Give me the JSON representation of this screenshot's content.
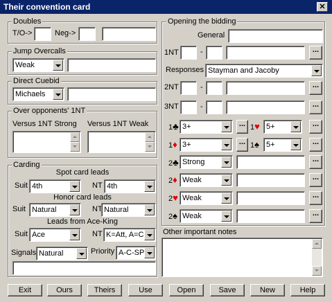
{
  "window": {
    "title": "Their convention card",
    "close_glyph": "✕"
  },
  "doubles": {
    "label": "Doubles",
    "to_label": "T/O->",
    "to_value": "",
    "neg_label": "Neg->",
    "neg_value": "",
    "notes": ""
  },
  "jump_overcalls": {
    "label": "Jump Overcalls",
    "value": "Weak",
    "notes": ""
  },
  "direct_cuebid": {
    "label": "Direct Cuebid",
    "value": "Michaels",
    "notes": ""
  },
  "over_1nt": {
    "label": "Over opponents' 1NT",
    "strong_label": "Versus 1NT Strong",
    "weak_label": "Versus 1NT Weak",
    "strong_value": "",
    "weak_value": ""
  },
  "carding": {
    "label": "Carding",
    "spot_label": "Spot card leads",
    "honor_label": "Honor card leads",
    "ace_king_label": "Leads from Ace-King",
    "suit_label": "Suit",
    "nt_label": "NT",
    "spot_suit": "4th",
    "spot_nt": "4th",
    "honor_suit": "Natural",
    "honor_nt": "Natural",
    "ak_suit": "Ace",
    "ak_nt": "K=Att, A=Cnt",
    "signals_label": "Signals",
    "signals_value": "Natural",
    "priority_label": "Priority",
    "priority_value": "A-C-SP",
    "notes": ""
  },
  "opening": {
    "label": "Opening the bidding",
    "general_label": "General",
    "general_value": "",
    "nt1_label": "1NT",
    "nt1_from": "",
    "nt1_to": "",
    "nt1_notes": "",
    "dash": "-",
    "responses_label": "Responses",
    "responses_value": "Stayman and Jacoby",
    "nt2_label": "2NT",
    "nt2_from": "",
    "nt2_to": "",
    "nt2_notes": "",
    "nt3_label": "3NT",
    "nt3_from": "",
    "nt3_to": "",
    "nt3_notes": "",
    "club1": {
      "level": "1",
      "suit": "♣",
      "value": "3+"
    },
    "heart1": {
      "level": "1",
      "suit": "♥",
      "value": "5+"
    },
    "diamond1": {
      "level": "1",
      "suit": "♦",
      "value": "3+"
    },
    "spade1": {
      "level": "1",
      "suit": "♠",
      "value": "5+"
    },
    "club2": {
      "level": "2",
      "suit": "♣",
      "value": "Strong",
      "notes": ""
    },
    "diamond2": {
      "level": "2",
      "suit": "♦",
      "value": "Weak",
      "notes": ""
    },
    "heart2": {
      "level": "2",
      "suit": "♥",
      "value": "Weak",
      "notes": ""
    },
    "spade2": {
      "level": "2",
      "suit": "♠",
      "value": "Weak",
      "notes": ""
    },
    "ellipsis": "..."
  },
  "other_notes": {
    "label": "Other important notes",
    "value": ""
  },
  "buttons": [
    "Exit",
    "Ours",
    "Theirs",
    "Use",
    "Open",
    "Save",
    "New",
    "Help"
  ],
  "colors": {
    "title_bg": "#0a246a",
    "face": "#d4d0c8",
    "red_suit": "#e00000"
  }
}
